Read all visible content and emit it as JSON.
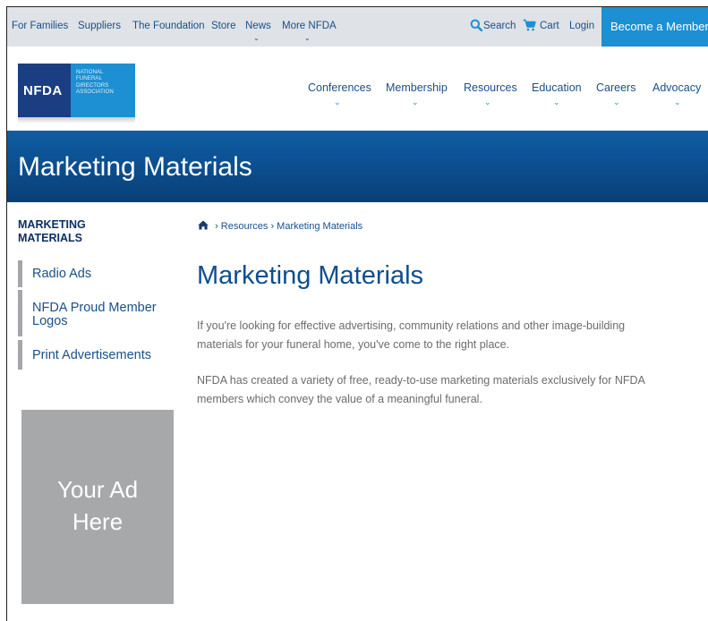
{
  "topbar": {
    "links": [
      "For Families",
      "Suppliers",
      "The Foundation",
      "Store",
      "News",
      "More NFDA"
    ],
    "search": "Search",
    "cart": "Cart",
    "login": "Login",
    "become_member": "Become a Member"
  },
  "logo": {
    "abbr": "NFDA",
    "full_name": [
      "NATIONAL",
      "FUNERAL",
      "DIRECTORS",
      "ASSOCIATION"
    ]
  },
  "mainnav": [
    "Conferences",
    "Membership",
    "Resources",
    "Education",
    "Careers",
    "Advocacy"
  ],
  "banner": {
    "title": "Marketing Materials"
  },
  "sidebar": {
    "title_line1": "MARKETING",
    "title_line2": "MATERIALS",
    "items": [
      {
        "label": "Radio Ads"
      },
      {
        "label_line1": "NFDA Proud Member",
        "label_line2": "Logos"
      },
      {
        "label": "Print Advertisements"
      }
    ],
    "ad_line1": "Your Ad",
    "ad_line2": "Here"
  },
  "breadcrumb": {
    "sep": "›",
    "items": [
      "Resources",
      "Marketing Materials"
    ]
  },
  "content": {
    "title": "Marketing Materials",
    "p1_line1": "If you're looking for effective advertising, community relations and other image-building",
    "p1_line2": "materials for your funeral home, you've come to the right place.",
    "p2_line1": "NFDA has created a variety of free, ready-to-use marketing materials exclusively for NFDA",
    "p2_line2": "members which convey the value of a meaningful funeral."
  },
  "icons": {
    "search": "search-icon",
    "cart": "cart-icon",
    "home": "home-icon",
    "chevron": "chevron-down-icon"
  },
  "colors": {
    "brand_navy": "#1b3e82",
    "brand_blue": "#1d8fd3",
    "banner_blue": "#0b4d8d",
    "link_blue": "#1a4f8a",
    "topbar_bg": "#dfe2e6",
    "ad_gray": "#a7a8aa"
  }
}
